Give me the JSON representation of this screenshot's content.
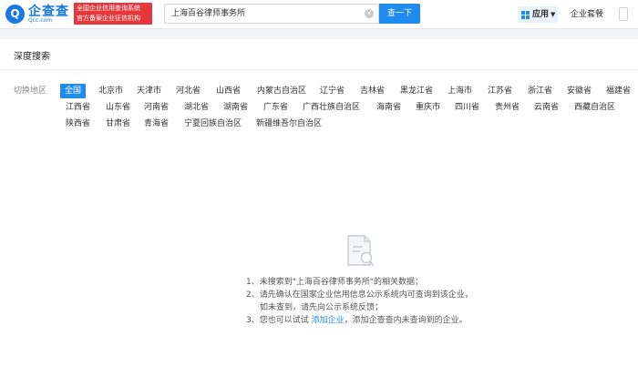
{
  "header": {
    "logo_text": "企查查",
    "logo_domain": "Qcc.com",
    "badge_line1": "全国企业信用查询系统",
    "badge_line2": "官方备案企业征信机构",
    "search_value": "上海百谷律师事务所",
    "search_button": "查一下",
    "app_label": "应用",
    "suite_label": "企业套餐"
  },
  "section": {
    "title": "深度搜索",
    "switch_label": "切换地区"
  },
  "regions": [
    "全国",
    "北京市",
    "天津市",
    "河北省",
    "山西省",
    "内蒙古自治区",
    "辽宁省",
    "吉林省",
    "黑龙江省",
    "上海市",
    "江苏省",
    "浙江省",
    "安徽省",
    "福建省",
    "江西省",
    "山东省",
    "河南省",
    "湖北省",
    "湖南省",
    "广东省",
    "广西壮族自治区",
    "海南省",
    "重庆市",
    "四川省",
    "贵州省",
    "云南省",
    "西藏自治区",
    "陕西省",
    "甘肃省",
    "青海省",
    "宁夏回族自治区",
    "新疆维吾尔自治区"
  ],
  "active_region": "全国",
  "empty": {
    "line1": "1、未搜索到\"上海百谷律师事务所\"的相关数据；",
    "line2": "2、请先确认在国家企业信用信息公示系统内可查询到该企业，",
    "line3": "如未查到，请先向公示系统反馈；",
    "line4_prefix": "3、您也可以试试 ",
    "line4_link": "添加企业",
    "line4_suffix": "，添加企查查内未查询到的企业。"
  },
  "colors": {
    "brand_blue": "#1f8bef",
    "badge_red": "#e6373b"
  }
}
